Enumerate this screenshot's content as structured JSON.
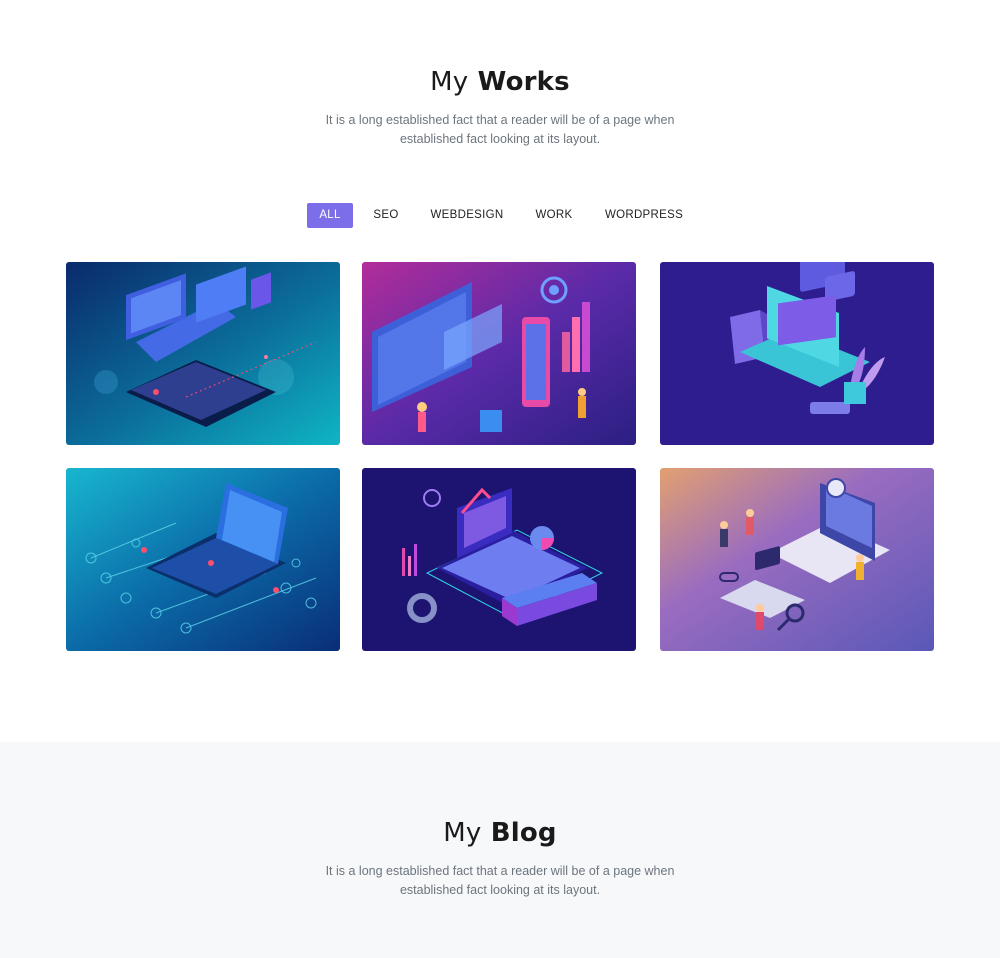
{
  "works": {
    "title_light": "My",
    "title_bold": "Works",
    "subtitle_line1": "It is a long established fact that a reader will be of a page when",
    "subtitle_line2": "established fact looking at its layout.",
    "filters": [
      {
        "label": "ALL",
        "active": true
      },
      {
        "label": "SEO",
        "active": false
      },
      {
        "label": "WEBDESIGN",
        "active": false
      },
      {
        "label": "WORK",
        "active": false
      },
      {
        "label": "WORDPRESS",
        "active": false
      }
    ],
    "accent_color": "#7c6ee8",
    "portfolio_items": [
      {
        "illustration": "laptop-multi-device-illustration"
      },
      {
        "illustration": "team-dashboard-illustration"
      },
      {
        "illustration": "online-shopping-laptop-illustration"
      },
      {
        "illustration": "circuit-laptop-illustration"
      },
      {
        "illustration": "analytics-laptop-illustration"
      },
      {
        "illustration": "web-development-team-illustration"
      }
    ]
  },
  "blog": {
    "title_light": "My",
    "title_bold": "Blog",
    "subtitle_line1": "It is a long established fact that a reader will be of a page when",
    "subtitle_line2": "established fact looking at its layout."
  }
}
